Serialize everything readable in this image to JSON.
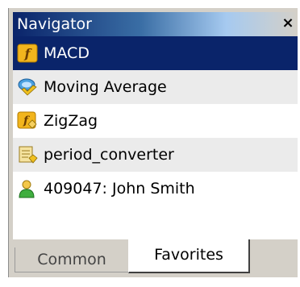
{
  "window": {
    "title": "Navigator",
    "close": "×"
  },
  "items": [
    {
      "label": "MACD",
      "icon": "function-icon"
    },
    {
      "label": "Moving Average",
      "icon": "indicator-icon"
    },
    {
      "label": "ZigZag",
      "icon": "custom-indicator-icon"
    },
    {
      "label": "period_converter",
      "icon": "script-icon"
    },
    {
      "label": "409047: John Smith",
      "icon": "account-icon"
    }
  ],
  "tabs": [
    {
      "label": "Common"
    },
    {
      "label": "Favorites"
    }
  ],
  "colors": {
    "selection": "#0a246a",
    "titlebar": "#0a246a",
    "panel": "#d4d0c8"
  }
}
